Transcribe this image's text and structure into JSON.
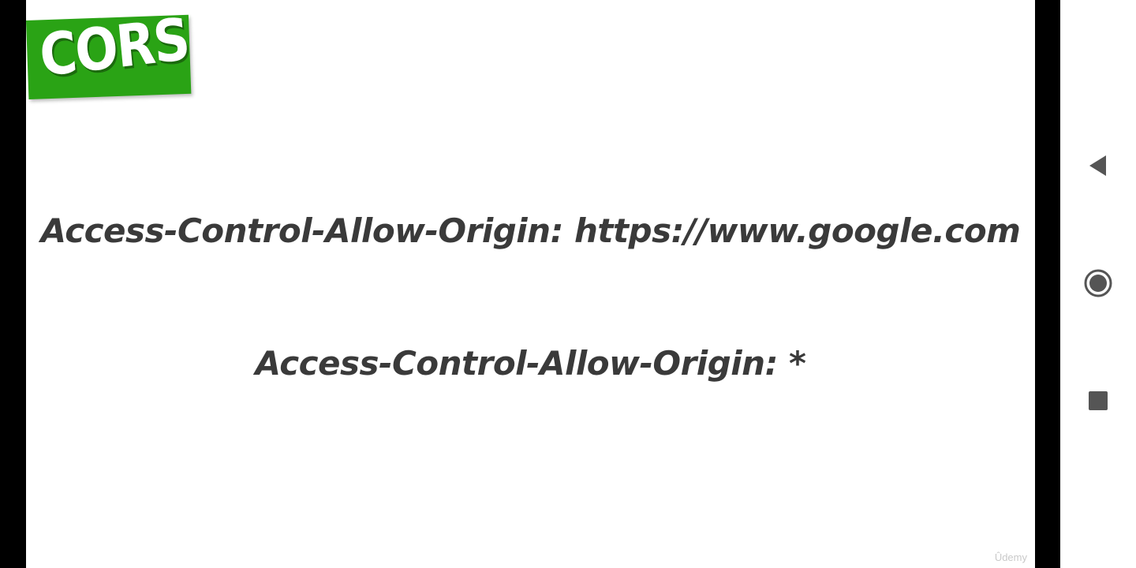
{
  "slide": {
    "badge_text": "CORS",
    "line_1": "Access-Control-Allow-Origin: https://www.google.com",
    "line_2": "Access-Control-Allow-Origin: *",
    "watermark": "Ûdemy"
  },
  "colors": {
    "badge": "#2aa315",
    "text": "#3a3a3a",
    "nav_icon": "#555555"
  },
  "nav": {
    "icons": [
      "back-triangle-icon",
      "home-circle-icon",
      "recents-square-icon"
    ]
  }
}
